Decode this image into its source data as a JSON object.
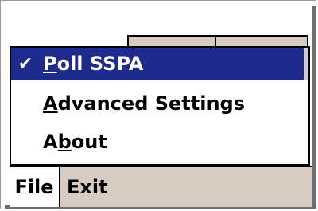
{
  "menu": {
    "items": [
      {
        "label_prefix": "",
        "label_underlined": "P",
        "label_suffix": "oll SSPA",
        "checked": true,
        "selected": true
      },
      {
        "label_prefix": "",
        "label_underlined": "A",
        "label_suffix": "dvanced Settings",
        "checked": false,
        "selected": false
      },
      {
        "label_prefix": "A",
        "label_underlined": "b",
        "label_suffix": "out",
        "checked": false,
        "selected": false
      }
    ],
    "check_glyph": "✔"
  },
  "menubar": {
    "file_label": "File",
    "exit_label": "Exit"
  },
  "colors": {
    "selection": "#1d2c8c",
    "menubar_bg": "#d7ccc2"
  }
}
